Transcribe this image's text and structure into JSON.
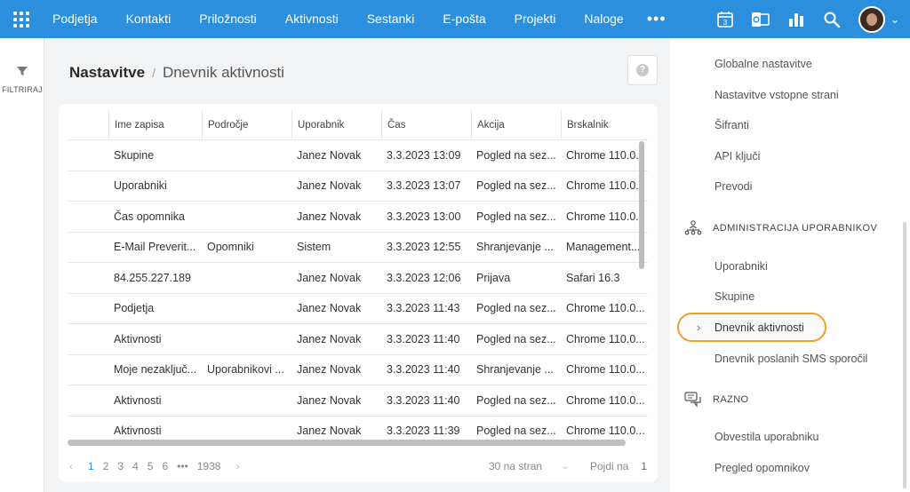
{
  "topnav": {
    "items": [
      "Podjetja",
      "Kontakti",
      "Priložnosti",
      "Aktivnosti",
      "Sestanki",
      "E-pošta",
      "Projekti",
      "Naloge"
    ],
    "more": "•••",
    "calendar_day": "3"
  },
  "filter": {
    "label": "FILTRIRAJ"
  },
  "breadcrumb": {
    "root": "Nastavitve",
    "separator": "/",
    "current": "Dnevnik aktivnosti"
  },
  "help": {
    "label": "?"
  },
  "table": {
    "columns": [
      "",
      "Ime zapisa",
      "Področje",
      "Uporabnik",
      "Čas",
      "Akcija",
      "Brskalnik"
    ],
    "rows": [
      [
        "",
        "Skupine",
        "",
        "Janez Novak",
        "3.3.2023 13:09",
        "Pogled na sez...",
        "Chrome 110.0..."
      ],
      [
        "",
        "Uporabniki",
        "",
        "Janez Novak",
        "3.3.2023 13:07",
        "Pogled na sez...",
        "Chrome 110.0..."
      ],
      [
        "",
        "Čas opomnika",
        "",
        "Janez Novak",
        "3.3.2023 13:00",
        "Pogled na sez...",
        "Chrome 110.0..."
      ],
      [
        "",
        "E-Mail Preverit...",
        "Opomniki",
        "Sistem",
        "3.3.2023 12:55",
        "Shranjevanje ...",
        "Management..."
      ],
      [
        "",
        "84.255.227.189",
        "",
        "Janez Novak",
        "3.3.2023 12:06",
        "Prijava",
        "Safari 16.3"
      ],
      [
        "",
        "Podjetja",
        "",
        "Janez Novak",
        "3.3.2023 11:43",
        "Pogled na sez...",
        "Chrome 110.0..."
      ],
      [
        "",
        "Aktivnosti",
        "",
        "Janez Novak",
        "3.3.2023 11:40",
        "Pogled na sez...",
        "Chrome 110.0..."
      ],
      [
        "",
        "Moje nezaključ...",
        "Uporabnikovi ...",
        "Janez Novak",
        "3.3.2023 11:40",
        "Shranjevanje ...",
        "Chrome 110.0..."
      ],
      [
        "",
        "Aktivnosti",
        "",
        "Janez Novak",
        "3.3.2023 11:40",
        "Pogled na sez...",
        "Chrome 110.0..."
      ],
      [
        "",
        "Aktivnosti",
        "",
        "Janez Novak",
        "3.3.2023 11:39",
        "Pogled na sez...",
        "Chrome 110.0..."
      ]
    ]
  },
  "pagination": {
    "prev": "‹",
    "next": "›",
    "pages": [
      "1",
      "2",
      "3",
      "4",
      "5",
      "6"
    ],
    "active_page": "1",
    "ellipsis": "•••",
    "last": "1938",
    "per_page": "30 na stran",
    "per_page_caret": "⌄",
    "goto_label": "Pojdi na",
    "goto_value": "1"
  },
  "settings_panel": {
    "items_top": [
      "Globalne nastavitve",
      "Nastavitve vstopne strani",
      "Šifranti",
      "API ključi",
      "Prevodi"
    ],
    "section_users": "ADMINISTRACIJA UPORABNIKOV",
    "users_items": [
      "Uporabniki",
      "Skupine"
    ],
    "selected_caret": "›",
    "selected": "Dnevnik aktivnosti",
    "users_after": "Dnevnik poslanih SMS sporočil",
    "section_misc": "RAZNO",
    "misc_items": [
      "Obvestila uporabniku",
      "Pregled opomnikov"
    ]
  },
  "colors": {
    "brand": "#2c8fdd",
    "highlight": "#f0a028"
  }
}
